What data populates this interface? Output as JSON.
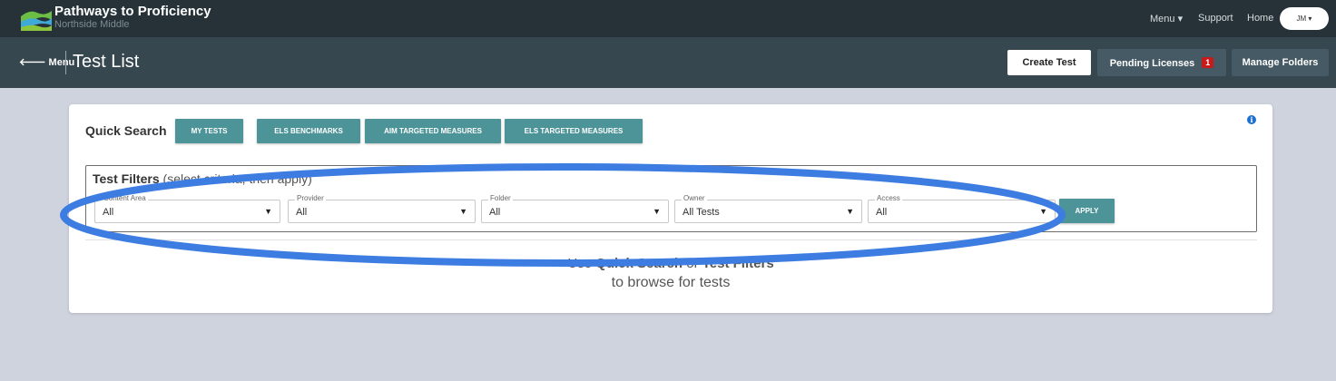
{
  "app": {
    "name": "Pathways to Proficiency",
    "school": "Northside Middle"
  },
  "top_nav": {
    "menu": "Menu ▾",
    "support": "Support",
    "home": "Home",
    "user_initials": "JM ▾"
  },
  "header": {
    "back_menu": "🡐 Menu",
    "title": "Test List",
    "create_test": "Create Test",
    "pending_licenses": "Pending Licenses",
    "pending_count": "1",
    "manage_folders": "Manage Folders"
  },
  "quick_search": {
    "label": "Quick Search",
    "buttons": [
      "MY TESTS",
      "ELS BENCHMARKS",
      "AIM TARGETED MEASURES",
      "ELS TARGETED MEASURES"
    ]
  },
  "test_filters": {
    "title": "Test Filters",
    "hint": "(select criteria, then apply)",
    "fields": [
      {
        "label": "Content Area",
        "value": "All"
      },
      {
        "label": "Provider",
        "value": "All"
      },
      {
        "label": "Folder",
        "value": "All"
      },
      {
        "label": "Owner",
        "value": "All Tests"
      },
      {
        "label": "Access",
        "value": "All"
      }
    ],
    "apply": "APPLY"
  },
  "empty_state": {
    "use": "Use",
    "quick_search": "Quick Search",
    "or": "or",
    "test_filters": "Test Filters",
    "line2": "to browse for tests"
  },
  "icons": {
    "logo": "landscape-logo-icon",
    "info": "info-icon",
    "dropdown": "caret-down-icon"
  },
  "colors": {
    "top_bar": "#263238",
    "header_bar": "#37474f",
    "accent_teal": "#4d9499",
    "badge_red": "#c81a1a",
    "annotation_blue": "#3d7de2"
  }
}
